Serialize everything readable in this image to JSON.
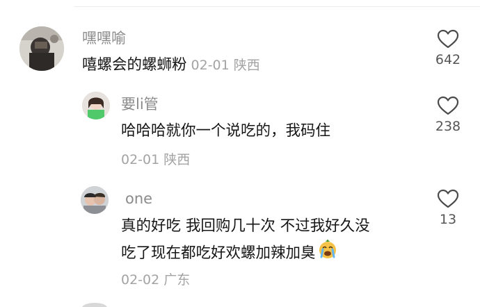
{
  "comments": [
    {
      "username": "嘿嘿喻",
      "text": "嘻螺会的螺蛳粉",
      "date": "02-01",
      "location": "陕西",
      "likes": "642"
    },
    {
      "username": "要li管",
      "text": "哈哈哈就你一个说吃的，我码住",
      "date": "02-01",
      "location": "陕西",
      "likes": "238"
    },
    {
      "username": "one",
      "text_line1": "真的好吃 我回购几十次 不过我好久没",
      "text_line2": "吃了现在都吃好欢螺加辣加臭",
      "emoji": "crying-face-emoji",
      "date": "02-02",
      "location": "广东",
      "likes": "13"
    }
  ],
  "icons": {
    "like": "heart-outline-icon"
  },
  "colors": {
    "text": "#161616",
    "username": "#8b8b8b",
    "meta": "#a3a3a3",
    "count": "#555555"
  }
}
